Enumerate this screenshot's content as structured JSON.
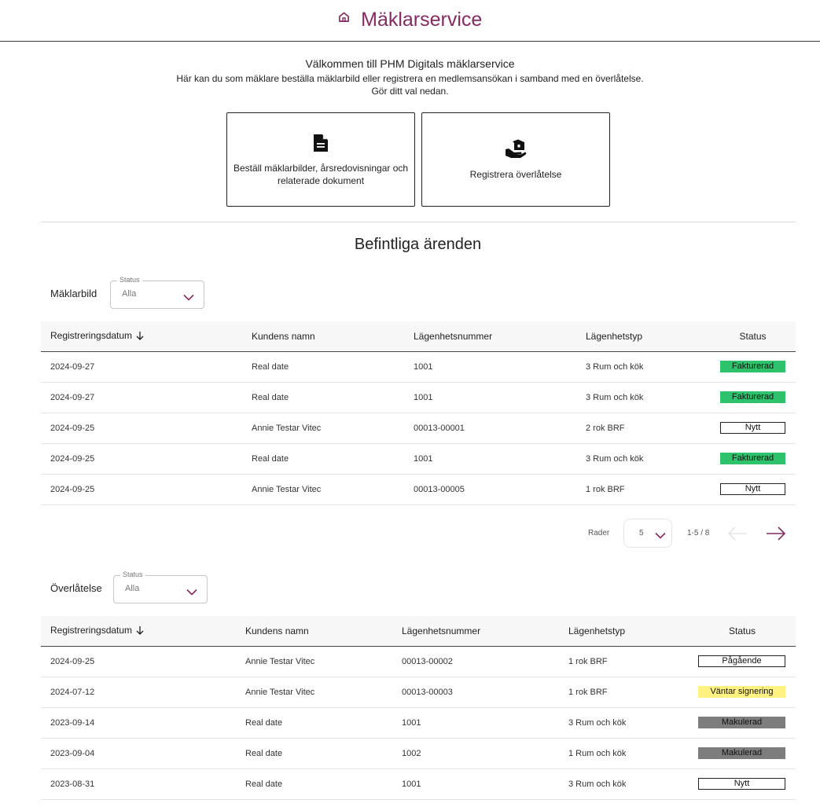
{
  "header": {
    "title": "Mäklarservice",
    "icon": "home-icon",
    "accent": "#862a63"
  },
  "intro": {
    "title": "Välkommen till PHM Digitals mäklarservice",
    "text": "Här kan du som mäklare beställa mäklarbild eller registrera en medlemsansökan i samband med en överlåtelse.",
    "hint": "Gör ditt val nedan."
  },
  "actions": [
    {
      "label": "Beställ mäklarbilder, årsredovisningar och relaterade dokument",
      "icon": "document-icon"
    },
    {
      "label": "Registrera överlåtelse",
      "icon": "hand-house-icon"
    }
  ],
  "existing": {
    "heading": "Befintliga ärenden"
  },
  "maklarbild": {
    "label": "Mäklarbild",
    "filter": {
      "legend": "Status",
      "value": "Alla"
    },
    "columns": [
      "Registreringsdatum",
      "Kundens namn",
      "Lägenhetsnummer",
      "Lägenhetstyp",
      "Status"
    ],
    "rows": [
      {
        "date": "2024-09-27",
        "name": "Real date",
        "number": "1001",
        "type": "3 Rum och kök",
        "status": "Fakturerad",
        "status_kind": "fakturerad"
      },
      {
        "date": "2024-09-27",
        "name": "Real date",
        "number": "1001",
        "type": "3 Rum och kök",
        "status": "Fakturerad",
        "status_kind": "fakturerad"
      },
      {
        "date": "2024-09-25",
        "name": "Annie Testar Vitec",
        "number": "00013-00001",
        "type": "2 rok BRF",
        "status": "Nytt",
        "status_kind": "nytt"
      },
      {
        "date": "2024-09-25",
        "name": "Real date",
        "number": "1001",
        "type": "3 Rum och kök",
        "status": "Fakturerad",
        "status_kind": "fakturerad"
      },
      {
        "date": "2024-09-25",
        "name": "Annie Testar Vitec",
        "number": "00013-00005",
        "type": "1 rok BRF",
        "status": "Nytt",
        "status_kind": "nytt"
      }
    ],
    "pagination": {
      "rows_label": "Rader",
      "rows_value": "5",
      "range": "1-5 / 8"
    }
  },
  "overlatelse": {
    "label": "Överlåtelse",
    "filter": {
      "legend": "Status",
      "value": "Alla"
    },
    "columns": [
      "Registreringsdatum",
      "Kundens namn",
      "Lägenhetsnummer",
      "Lägenhetstyp",
      "Status"
    ],
    "rows": [
      {
        "date": "2024-09-25",
        "name": "Annie Testar Vitec",
        "number": "00013-00002",
        "type": "1 rok BRF",
        "status": "Pågående",
        "status_kind": "pagaende"
      },
      {
        "date": "2024-07-12",
        "name": "Annie Testar Vitec",
        "number": "00013-00003",
        "type": "1 rok BRF",
        "status": "Väntar signering",
        "status_kind": "vantar"
      },
      {
        "date": "2023-09-14",
        "name": "Real date",
        "number": "1001",
        "type": "3 Rum och kök",
        "status": "Makulerad",
        "status_kind": "makulerad"
      },
      {
        "date": "2023-09-04",
        "name": "Real date",
        "number": "1002",
        "type": "1 Rum och kök",
        "status": "Makulerad",
        "status_kind": "makulerad"
      },
      {
        "date": "2023-08-31",
        "name": "Real date",
        "number": "1001",
        "type": "3 Rum och kök",
        "status": "Nytt",
        "status_kind": "nytt"
      }
    ]
  },
  "colors": {
    "fakturerad": "#2dc26b",
    "vantar": "#fff281",
    "makulerad": "#7d7d7d",
    "accent": "#862a63"
  }
}
